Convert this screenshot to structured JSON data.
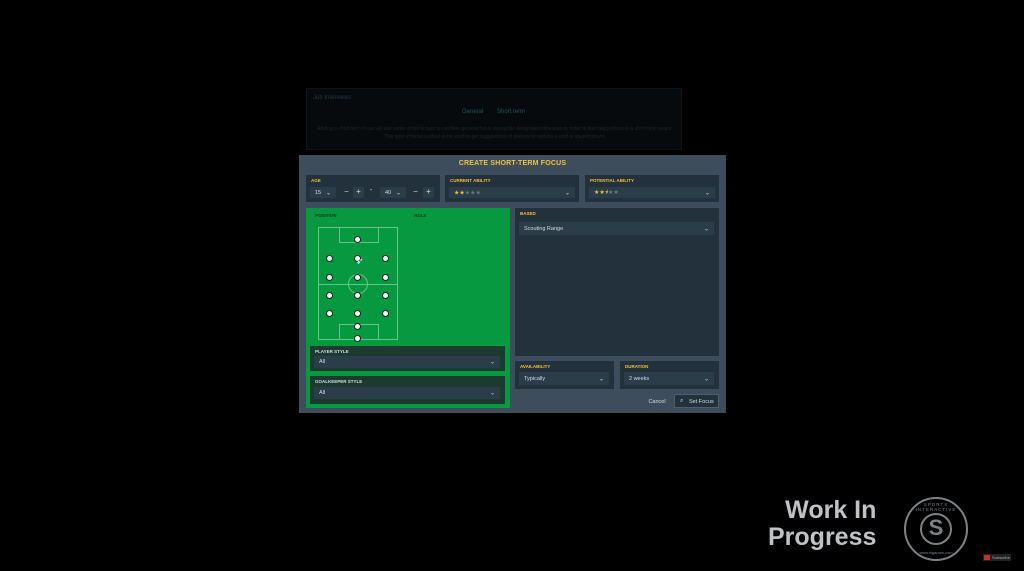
{
  "background": {
    "header": "Job Interviews",
    "tabs": [
      "General",
      "Short term"
    ],
    "description": "Adding a short term focus will ask some of the scouts to not their general focus during the designated timespan in order to find suggestions in a short time space. This type of focus is ideal to be used to get suggestions of players to replace a sold or injured player."
  },
  "dialog": {
    "title": "CREATE SHORT-TERM FOCUS",
    "age": {
      "label": "AGE",
      "min_value": "15",
      "max_value": "40",
      "minus": "−",
      "plus": "+",
      "separator": "-"
    },
    "current_ability": {
      "label": "CURRENT ABILITY",
      "stars": 2,
      "max_stars": 5
    },
    "potential_ability": {
      "label": "POTENTIAL ABILITY",
      "stars": 2.5,
      "max_stars": 5
    },
    "position_label": "POSITION",
    "role_label": "ROLE",
    "player_style": {
      "label": "PLAYER STYLE",
      "value": "All"
    },
    "goalkeeper_style": {
      "label": "GOALKEEPER STYLE",
      "value": "All"
    },
    "based": {
      "label": "BASED",
      "value": "Scouting Range"
    },
    "availability": {
      "label": "AVAILABILITY",
      "value": "Typically"
    },
    "duration": {
      "label": "DURATION",
      "value": "2 weeks"
    },
    "cancel_label": "Cancel",
    "set_focus_label": "Set Focus"
  },
  "watermark": {
    "line1": "Work In",
    "line2": "Progress",
    "logo_top": "SPORTS INTERACTIVE",
    "logo_bottom": "www.sigames.com",
    "logo_letter": "S"
  },
  "yt_badge": "Subscribe",
  "colors": {
    "accent": "#f2c23b",
    "pitch_green": "#07993f",
    "panel": "#22313c",
    "dialog": "#3d4d5b"
  }
}
